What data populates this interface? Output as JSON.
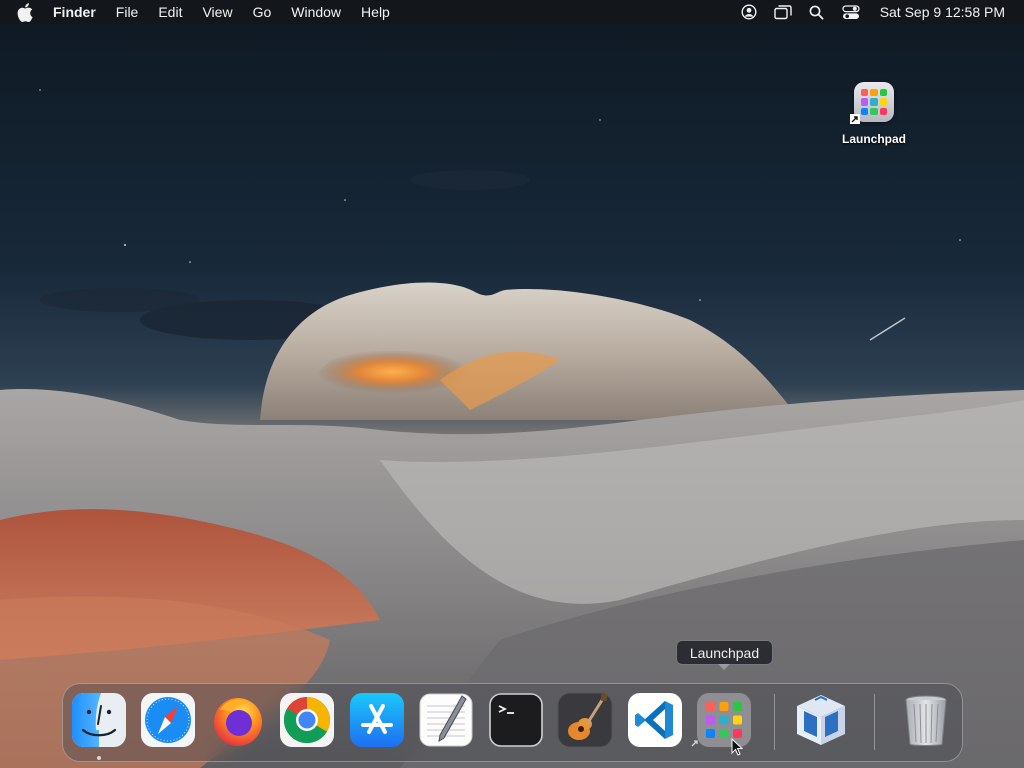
{
  "menubar": {
    "app_name": "Finder",
    "menus": [
      "File",
      "Edit",
      "View",
      "Go",
      "Window",
      "Help"
    ],
    "status_icons": [
      "user-account-icon",
      "screen-mirroring-icon",
      "spotlight-search-icon",
      "control-center-icon"
    ],
    "clock": "Sat Sep 9  12:58 PM"
  },
  "desktop": {
    "icons": [
      {
        "label": "Launchpad",
        "icon": "launchpad-icon"
      }
    ]
  },
  "dock": {
    "tooltip": "Launchpad",
    "apps": [
      {
        "name": "Finder",
        "icon": "finder-icon",
        "running": true
      },
      {
        "name": "Safari",
        "icon": "safari-icon"
      },
      {
        "name": "Firefox",
        "icon": "firefox-icon"
      },
      {
        "name": "Google Chrome",
        "icon": "chrome-icon"
      },
      {
        "name": "App Store",
        "icon": "app-store-icon"
      },
      {
        "name": "TextEdit",
        "icon": "textedit-icon"
      },
      {
        "name": "Terminal",
        "icon": "terminal-icon"
      },
      {
        "name": "GarageBand",
        "icon": "garageband-icon"
      },
      {
        "name": "Visual Studio Code",
        "icon": "vscode-icon"
      },
      {
        "name": "Launchpad",
        "icon": "launchpad-icon"
      },
      {
        "name": "VirtualBox",
        "icon": "virtualbox-icon"
      },
      {
        "name": "Trash",
        "icon": "trash-icon"
      }
    ]
  },
  "colors": {
    "menubar_bg": "#14161a",
    "sky_top": "#0f1a24",
    "sky_horizon": "#c69468",
    "rock_orange": "#e0923f"
  }
}
